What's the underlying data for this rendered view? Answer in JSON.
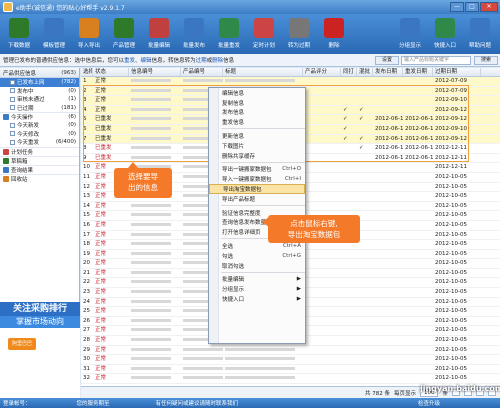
{
  "window": {
    "title": "e助手(诚信通) 您的贴心好帮手 v2.9.1.7"
  },
  "toolbar": [
    {
      "label": "下载数据",
      "color": "#2f7a2a",
      "icon": "download-icon"
    },
    {
      "label": "模板管理",
      "color": "#3a76c2",
      "icon": "template-icon"
    },
    {
      "label": "导入导出",
      "color": "#d87f1f",
      "icon": "import-export-icon"
    },
    {
      "label": "产品管理",
      "color": "#2f7a2a",
      "icon": "product-icon"
    },
    {
      "label": "批量编辑",
      "color": "#c04040",
      "icon": "edit-icon"
    },
    {
      "label": "批量发布",
      "color": "#3a76c2",
      "icon": "publish-icon"
    },
    {
      "label": "批量重发",
      "color": "#2f8a4a",
      "icon": "republish-icon"
    },
    {
      "label": "定时计划",
      "color": "#c44",
      "icon": "calendar-icon"
    },
    {
      "label": "转为过期",
      "color": "#777",
      "icon": "expire-icon"
    },
    {
      "label": "删除",
      "color": "#c22",
      "icon": "delete-icon"
    },
    {
      "label": "分组显示",
      "color": "#3a76c2",
      "icon": "group-icon"
    },
    {
      "label": "快捷入口",
      "color": "#2f8a4a",
      "icon": "shortcut-icon"
    },
    {
      "label": "帮助问题",
      "color": "#3a76c2",
      "icon": "help-icon"
    }
  ],
  "window_buttons": {
    "min": "—",
    "max": "□",
    "close": "✕"
  },
  "infobar": {
    "prefix": "管理已发布的普通供应信息：选中信息后，您可以",
    "link1": "重发",
    "sep1": "、",
    "link2": "编辑",
    "mid": "信息，转信息转为",
    "link3": "过期",
    "sep2": "或",
    "link4": "删除",
    "suffix": "信息",
    "search_placeholder": "输入产品标题关键字",
    "search_btn": "搜索",
    "settings_btn": "设置"
  },
  "sidebar": {
    "header": {
      "label": "产品供应信息",
      "count": "(963)"
    },
    "items": [
      {
        "label": "已发布上网",
        "count": "(782)",
        "selected": true
      },
      {
        "label": "发布中",
        "count": "(0)",
        "selected": false
      },
      {
        "label": "审核未通过",
        "count": "(1)",
        "selected": false
      },
      {
        "label": "已过期",
        "count": "(181)",
        "selected": false
      }
    ],
    "group2": {
      "label": "今天操作",
      "count": "(6)"
    },
    "items2": [
      {
        "label": "今天新发",
        "count": "(0)"
      },
      {
        "label": "今天修改",
        "count": "(0)"
      },
      {
        "label": "今天重发",
        "count": "(6/400)"
      }
    ],
    "groups": [
      "计划任务",
      "草稿箱",
      "查询结果",
      "回收站"
    ],
    "promo": {
      "line1": "关注采购排行",
      "line2": "掌握市场动向",
      "logo": "阿里巴巴"
    }
  },
  "table": {
    "headers": [
      "选择",
      "状态",
      "信息编号",
      "产品编号",
      "标题",
      "产品评分",
      "同打",
      "混批",
      "发布日期",
      "重发日期",
      "过期日期"
    ],
    "rows": [
      {
        "n": "1",
        "status": "正常",
        "red": false,
        "hl": true,
        "ship": "",
        "mix": "",
        "pub": "",
        "rep": "",
        "exp": "2012-07-09"
      },
      {
        "n": "2",
        "status": "正常",
        "red": false,
        "hl": true,
        "ship": "",
        "mix": "",
        "pub": "",
        "rep": "",
        "exp": "2012-07-09"
      },
      {
        "n": "3",
        "status": "正常",
        "red": false,
        "hl": true,
        "ship": "",
        "mix": "",
        "pub": "",
        "rep": "",
        "exp": "2012-09-10"
      },
      {
        "n": "4",
        "status": "正常",
        "red": false,
        "hl": true,
        "ship": "✓",
        "mix": "✓",
        "pub": "",
        "rep": "",
        "exp": "2012-09-12"
      },
      {
        "n": "5",
        "status": "已重发",
        "red": false,
        "hl": true,
        "ship": "✓",
        "mix": "✓",
        "pub": "2012-06-14",
        "rep": "2012-06-14",
        "exp": "2012-09-12"
      },
      {
        "n": "6",
        "status": "已重发",
        "red": false,
        "hl": true,
        "ship": "✓",
        "mix": "",
        "pub": "2012-06-14",
        "rep": "2012-06-14",
        "exp": "2012-09-10"
      },
      {
        "n": "7",
        "status": "已重发",
        "red": false,
        "hl": true,
        "ship": "✓",
        "mix": "✓",
        "pub": "2012-06-14",
        "rep": "2012-06-14",
        "exp": "2012-09-12"
      },
      {
        "n": "8",
        "status": "已重发",
        "red": true,
        "hl": false,
        "ship": "",
        "mix": "✓",
        "pub": "2012-06-14",
        "rep": "2012-06-14",
        "exp": "2012-12-11"
      },
      {
        "n": "9",
        "status": "已重发",
        "red": true,
        "hl": false,
        "ship": "",
        "mix": "",
        "pub": "2012-06-14",
        "rep": "2012-06-14",
        "exp": "2012-12-11"
      },
      {
        "n": "10",
        "status": "正常",
        "red": true,
        "hl": false,
        "ship": "",
        "mix": "",
        "pub": "",
        "rep": "",
        "exp": "2012-12-11"
      },
      {
        "n": "11",
        "status": "正常",
        "red": true,
        "hl": false,
        "ship": "",
        "mix": "",
        "pub": "",
        "rep": "",
        "exp": "2012-10-05"
      },
      {
        "n": "12",
        "status": "正常",
        "red": true,
        "hl": false,
        "ship": "",
        "mix": "",
        "pub": "",
        "rep": "",
        "exp": "2012-10-05"
      },
      {
        "n": "13",
        "status": "正常",
        "red": true,
        "hl": false,
        "ship": "",
        "mix": "",
        "pub": "",
        "rep": "",
        "exp": "2012-10-05"
      },
      {
        "n": "14",
        "status": "正常",
        "red": true,
        "hl": false,
        "ship": "",
        "mix": "",
        "pub": "",
        "rep": "",
        "exp": "2012-10-05"
      },
      {
        "n": "15",
        "status": "正常",
        "red": true,
        "hl": false,
        "ship": "",
        "mix": "",
        "pub": "",
        "rep": "",
        "exp": "2012-10-05"
      },
      {
        "n": "16",
        "status": "正常",
        "red": true,
        "hl": false,
        "ship": "",
        "mix": "",
        "pub": "",
        "rep": "",
        "exp": "2012-10-05"
      },
      {
        "n": "17",
        "status": "正常",
        "red": true,
        "hl": false,
        "ship": "",
        "mix": "",
        "pub": "",
        "rep": "",
        "exp": "2012-10-05"
      },
      {
        "n": "18",
        "status": "正常",
        "red": true,
        "hl": false,
        "ship": "",
        "mix": "",
        "pub": "",
        "rep": "",
        "exp": "2012-10-05"
      },
      {
        "n": "19",
        "status": "正常",
        "red": true,
        "hl": false,
        "ship": "",
        "mix": "",
        "pub": "",
        "rep": "",
        "exp": "2012-10-05"
      },
      {
        "n": "20",
        "status": "正常",
        "red": true,
        "hl": false,
        "ship": "",
        "mix": "",
        "pub": "",
        "rep": "",
        "exp": "2012-10-05"
      },
      {
        "n": "21",
        "status": "正常",
        "red": true,
        "hl": false,
        "ship": "",
        "mix": "",
        "pub": "",
        "rep": "",
        "exp": "2012-10-05"
      },
      {
        "n": "22",
        "status": "正常",
        "red": true,
        "hl": false,
        "ship": "",
        "mix": "",
        "pub": "",
        "rep": "",
        "exp": "2012-10-05"
      },
      {
        "n": "23",
        "status": "正常",
        "red": true,
        "hl": false,
        "ship": "",
        "mix": "",
        "pub": "",
        "rep": "",
        "exp": "2012-10-05"
      },
      {
        "n": "24",
        "status": "正常",
        "red": true,
        "hl": false,
        "ship": "",
        "mix": "",
        "pub": "",
        "rep": "",
        "exp": "2012-10-05"
      },
      {
        "n": "25",
        "status": "正常",
        "red": true,
        "hl": false,
        "ship": "",
        "mix": "",
        "pub": "",
        "rep": "",
        "exp": "2012-10-05"
      },
      {
        "n": "26",
        "status": "正常",
        "red": true,
        "hl": false,
        "ship": "",
        "mix": "",
        "pub": "",
        "rep": "",
        "exp": "2012-10-05"
      },
      {
        "n": "27",
        "status": "正常",
        "red": true,
        "hl": false,
        "ship": "",
        "mix": "",
        "pub": "",
        "rep": "",
        "exp": "2012-10-05"
      },
      {
        "n": "28",
        "status": "正常",
        "red": true,
        "hl": false,
        "ship": "",
        "mix": "",
        "pub": "",
        "rep": "",
        "exp": "2012-10-05"
      },
      {
        "n": "29",
        "status": "正常",
        "red": true,
        "hl": false,
        "ship": "",
        "mix": "",
        "pub": "",
        "rep": "",
        "exp": "2012-10-05"
      },
      {
        "n": "30",
        "status": "正常",
        "red": true,
        "hl": false,
        "ship": "",
        "mix": "",
        "pub": "",
        "rep": "",
        "exp": "2012-10-05"
      },
      {
        "n": "31",
        "status": "正常",
        "red": true,
        "hl": false,
        "ship": "",
        "mix": "",
        "pub": "",
        "rep": "",
        "exp": "2012-10-05"
      },
      {
        "n": "32",
        "status": "正常",
        "red": true,
        "hl": false,
        "ship": "",
        "mix": "",
        "pub": "",
        "rep": "",
        "exp": "2012-10-05"
      }
    ]
  },
  "context_menu": [
    {
      "label": "编辑信息",
      "sc": "",
      "icon": "edit-icon"
    },
    {
      "label": "复制信息",
      "sc": ""
    },
    {
      "label": "发布信息",
      "sc": ""
    },
    {
      "label": "重发信息",
      "sc": ""
    },
    {
      "sep": true
    },
    {
      "label": "更新信息",
      "sc": ""
    },
    {
      "label": "下载图片",
      "sc": ""
    },
    {
      "label": "删除共享缓存",
      "sc": ""
    },
    {
      "sep": true
    },
    {
      "label": "导出一键搬家数据包",
      "sc": "Ctrl+O"
    },
    {
      "label": "导入一键搬家数据包",
      "sc": "Ctrl+I"
    },
    {
      "label": "导出淘宝数据包",
      "sc": "",
      "active": true
    },
    {
      "label": "导出产品标题",
      "sc": ""
    },
    {
      "sep": true
    },
    {
      "label": "验证信息完整度",
      "sc": ""
    },
    {
      "label": "查询信息发布数量",
      "sc": ""
    },
    {
      "label": "打开信息详细页",
      "sc": ""
    },
    {
      "sep": true
    },
    {
      "label": "全选",
      "sc": "Ctrl+A"
    },
    {
      "label": "勾选",
      "sc": "Ctrl+G"
    },
    {
      "label": "取消勾选",
      "sc": ""
    },
    {
      "sep": true
    },
    {
      "label": "批量编辑",
      "sc": "",
      "arrow": "▶"
    },
    {
      "label": "分组显示",
      "sc": "",
      "arrow": "▶"
    },
    {
      "label": "快捷入口",
      "sc": "",
      "arrow": "▶"
    }
  ],
  "callouts": {
    "c1_line1": "选择要导",
    "c1_line2": "出的信息",
    "c2_line1": "点击鼠标右键,",
    "c2_line2": "导出淘宝数据包"
  },
  "pager": {
    "total": "共 782 条",
    "per_page_label": "每页显示",
    "per_page": "100",
    "unit": "条"
  },
  "statusbar": {
    "user_label": "登录帐号：",
    "notice1": "您的服务期至",
    "notice2": "有任何疑问或建议请随时联系我们",
    "right": "检查升级"
  },
  "watermark": "jingyan.baidu.com",
  "colors": {
    "accent": "#3b7cc6",
    "highlight": "#fff8c8",
    "callout": "#f47a2a",
    "selected": "#3d7fd2"
  }
}
